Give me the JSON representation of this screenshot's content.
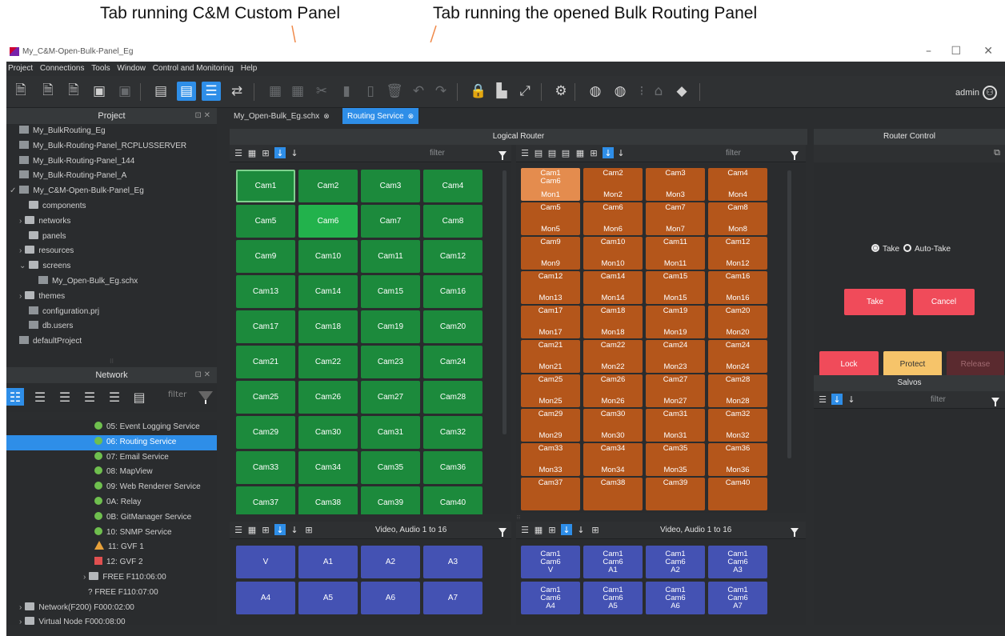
{
  "annotations": {
    "left": "Tab running C&M Custom Panel",
    "right": "Tab running the opened Bulk Routing Panel"
  },
  "window": {
    "title": "My_C&M-Open-Bulk-Panel_Eg",
    "controls": [
      "–",
      "☐",
      "✕"
    ]
  },
  "menu": [
    "Project",
    "Connections",
    "Tools",
    "Window",
    "Control and Monitoring",
    "Help"
  ],
  "toolbar": {
    "user": "admin"
  },
  "project_panel": {
    "title": "Project",
    "items": [
      {
        "label": "My_BulkRouting_Eg",
        "icon": "file-icon",
        "indent": 0
      },
      {
        "label": "My_Bulk-Routing-Panel_RCPLUSSERVER",
        "icon": "file-icon",
        "indent": 0
      },
      {
        "label": "My_Bulk-Routing-Panel_144",
        "icon": "file-icon",
        "indent": 0
      },
      {
        "label": "My_Bulk-Routing-Panel_A",
        "icon": "file-icon",
        "indent": 0
      },
      {
        "label": "My_C&M-Open-Bulk-Panel_Eg",
        "icon": "file-icon",
        "indent": 0,
        "arrow": "✓"
      },
      {
        "label": "components",
        "icon": "folder-icon",
        "indent": 1
      },
      {
        "label": "networks",
        "icon": "folder-icon",
        "indent": 1,
        "arrow": "›"
      },
      {
        "label": "panels",
        "icon": "folder-icon",
        "indent": 1
      },
      {
        "label": "resources",
        "icon": "folder-icon",
        "indent": 1,
        "arrow": "›"
      },
      {
        "label": "screens",
        "icon": "folder-icon",
        "indent": 1,
        "arrow": "⌄"
      },
      {
        "label": "My_Open-Bulk_Eg.schx",
        "icon": "file-icon",
        "indent": 2
      },
      {
        "label": "themes",
        "icon": "folder-icon",
        "indent": 1,
        "arrow": "›"
      },
      {
        "label": "configuration.prj",
        "icon": "file-icon",
        "indent": 1
      },
      {
        "label": "db.users",
        "icon": "file-icon",
        "indent": 1
      },
      {
        "label": "defaultProject",
        "icon": "file-icon",
        "indent": 0
      }
    ]
  },
  "network_panel": {
    "title": "Network",
    "filter": "filter",
    "items": [
      {
        "label": "05: Event Logging Service",
        "status": "green"
      },
      {
        "label": "06: Routing Service",
        "status": "green",
        "selected": true
      },
      {
        "label": "07: Email Service",
        "status": "green"
      },
      {
        "label": "08: MapView",
        "status": "green"
      },
      {
        "label": "09: Web Renderer Service",
        "status": "green"
      },
      {
        "label": "0A: Relay",
        "status": "green"
      },
      {
        "label": "0B: GitManager Service",
        "status": "green"
      },
      {
        "label": "10: SNMP Service",
        "status": "green"
      },
      {
        "label": "11: GVF 1",
        "status": "warning"
      },
      {
        "label": "12: GVF 2",
        "status": "error"
      },
      {
        "label": "FREE F110:06:00",
        "status": "folder",
        "arrow": "›"
      },
      {
        "label": "FREE F110:07:00",
        "status": "unknown"
      },
      {
        "label": "Network(F200) F000:02:00",
        "status": "folder",
        "arrow": "›",
        "outdent": true
      },
      {
        "label": "Virtual Node F000:08:00",
        "status": "folder",
        "arrow": "›",
        "outdent": true
      }
    ]
  },
  "tabs": [
    {
      "label": "My_Open-Bulk_Eg.schx",
      "active": false
    },
    {
      "label": "Routing Service",
      "active": true
    }
  ],
  "logical_router": {
    "title": "Logical Router",
    "source_filter": "filter",
    "dest_filter": "filter",
    "level_label_left": "Video, Audio 1 to 16",
    "level_label_right": "Video, Audio 1 to 16",
    "sources": [
      "Cam1",
      "Cam2",
      "Cam3",
      "Cam4",
      "Cam5",
      "Cam6",
      "Cam7",
      "Cam8",
      "Cam9",
      "Cam10",
      "Cam11",
      "Cam12",
      "Cam13",
      "Cam14",
      "Cam15",
      "Cam16",
      "Cam17",
      "Cam18",
      "Cam19",
      "Cam20",
      "Cam21",
      "Cam22",
      "Cam23",
      "Cam24",
      "Cam25",
      "Cam26",
      "Cam27",
      "Cam28",
      "Cam29",
      "Cam30",
      "Cam31",
      "Cam32",
      "Cam33",
      "Cam34",
      "Cam35",
      "Cam36",
      "Cam37",
      "Cam38",
      "Cam39",
      "Cam40"
    ],
    "destinations": [
      {
        "src": "Cam1",
        "src2": "Cam6",
        "dst": "Mon1"
      },
      {
        "src": "Cam2",
        "dst": "Mon2"
      },
      {
        "src": "Cam3",
        "dst": "Mon3"
      },
      {
        "src": "Cam4",
        "dst": "Mon4"
      },
      {
        "src": "Cam5",
        "dst": "Mon5"
      },
      {
        "src": "Cam6",
        "dst": "Mon6"
      },
      {
        "src": "Cam7",
        "dst": "Mon7"
      },
      {
        "src": "Cam8",
        "dst": "Mon8"
      },
      {
        "src": "Cam9",
        "dst": "Mon9"
      },
      {
        "src": "Cam10",
        "dst": "Mon10"
      },
      {
        "src": "Cam11",
        "dst": "Mon11"
      },
      {
        "src": "Cam12",
        "dst": "Mon12"
      },
      {
        "src": "Cam12",
        "dst": "Mon13"
      },
      {
        "src": "Cam14",
        "dst": "Mon14"
      },
      {
        "src": "Cam15",
        "dst": "Mon15"
      },
      {
        "src": "Cam16",
        "dst": "Mon16"
      },
      {
        "src": "Cam17",
        "dst": "Mon17"
      },
      {
        "src": "Cam18",
        "dst": "Mon18"
      },
      {
        "src": "Cam19",
        "dst": "Mon19"
      },
      {
        "src": "Cam20",
        "dst": "Mon20"
      },
      {
        "src": "Cam21",
        "dst": "Mon21"
      },
      {
        "src": "Cam22",
        "dst": "Mon22"
      },
      {
        "src": "Cam24",
        "dst": "Mon23"
      },
      {
        "src": "Cam24",
        "dst": "Mon24"
      },
      {
        "src": "Cam25",
        "dst": "Mon25"
      },
      {
        "src": "Cam26",
        "dst": "Mon26"
      },
      {
        "src": "Cam27",
        "dst": "Mon27"
      },
      {
        "src": "Cam28",
        "dst": "Mon28"
      },
      {
        "src": "Cam29",
        "dst": "Mon29"
      },
      {
        "src": "Cam30",
        "dst": "Mon30"
      },
      {
        "src": "Cam31",
        "dst": "Mon31"
      },
      {
        "src": "Cam32",
        "dst": "Mon32"
      },
      {
        "src": "Cam33",
        "dst": "Mon33"
      },
      {
        "src": "Cam34",
        "dst": "Mon34"
      },
      {
        "src": "Cam35",
        "dst": "Mon35"
      },
      {
        "src": "Cam36",
        "dst": "Mon36"
      },
      {
        "src": "Cam37",
        "dst": ""
      },
      {
        "src": "Cam38",
        "dst": ""
      },
      {
        "src": "Cam39",
        "dst": ""
      },
      {
        "src": "Cam40",
        "dst": ""
      }
    ],
    "source_levels": [
      "V",
      "A1",
      "A2",
      "A3",
      "A4",
      "A5",
      "A6",
      "A7"
    ],
    "dest_levels": [
      {
        "l1": "Cam1",
        "l2": "Cam6",
        "l3": "V"
      },
      {
        "l1": "Cam1",
        "l2": "Cam6",
        "l3": "A1"
      },
      {
        "l1": "Cam1",
        "l2": "Cam6",
        "l3": "A2"
      },
      {
        "l1": "Cam1",
        "l2": "Cam6",
        "l3": "A3"
      },
      {
        "l1": "Cam1",
        "l2": "Cam6",
        "l3": "A4"
      },
      {
        "l1": "Cam1",
        "l2": "Cam6",
        "l3": "A5"
      },
      {
        "l1": "Cam1",
        "l2": "Cam6",
        "l3": "A6"
      },
      {
        "l1": "Cam1",
        "l2": "Cam6",
        "l3": "A7"
      }
    ]
  },
  "router_control": {
    "title": "Router Control",
    "take_radio": "Take",
    "auto_take_radio": "Auto-Take",
    "take_button": "Take",
    "cancel_button": "Cancel",
    "lock_button": "Lock",
    "protect_button": "Protect",
    "release_button": "Release"
  },
  "salvos": {
    "title": "Salvos",
    "filter": "filter"
  },
  "colors": {
    "accent": "#2e8ee8",
    "source_green": "#1c8a3c",
    "dest_orange": "#b4561b",
    "level_blue": "#4452b3",
    "take_red": "#f04b5a",
    "protect_yellow": "#f6c46a"
  }
}
